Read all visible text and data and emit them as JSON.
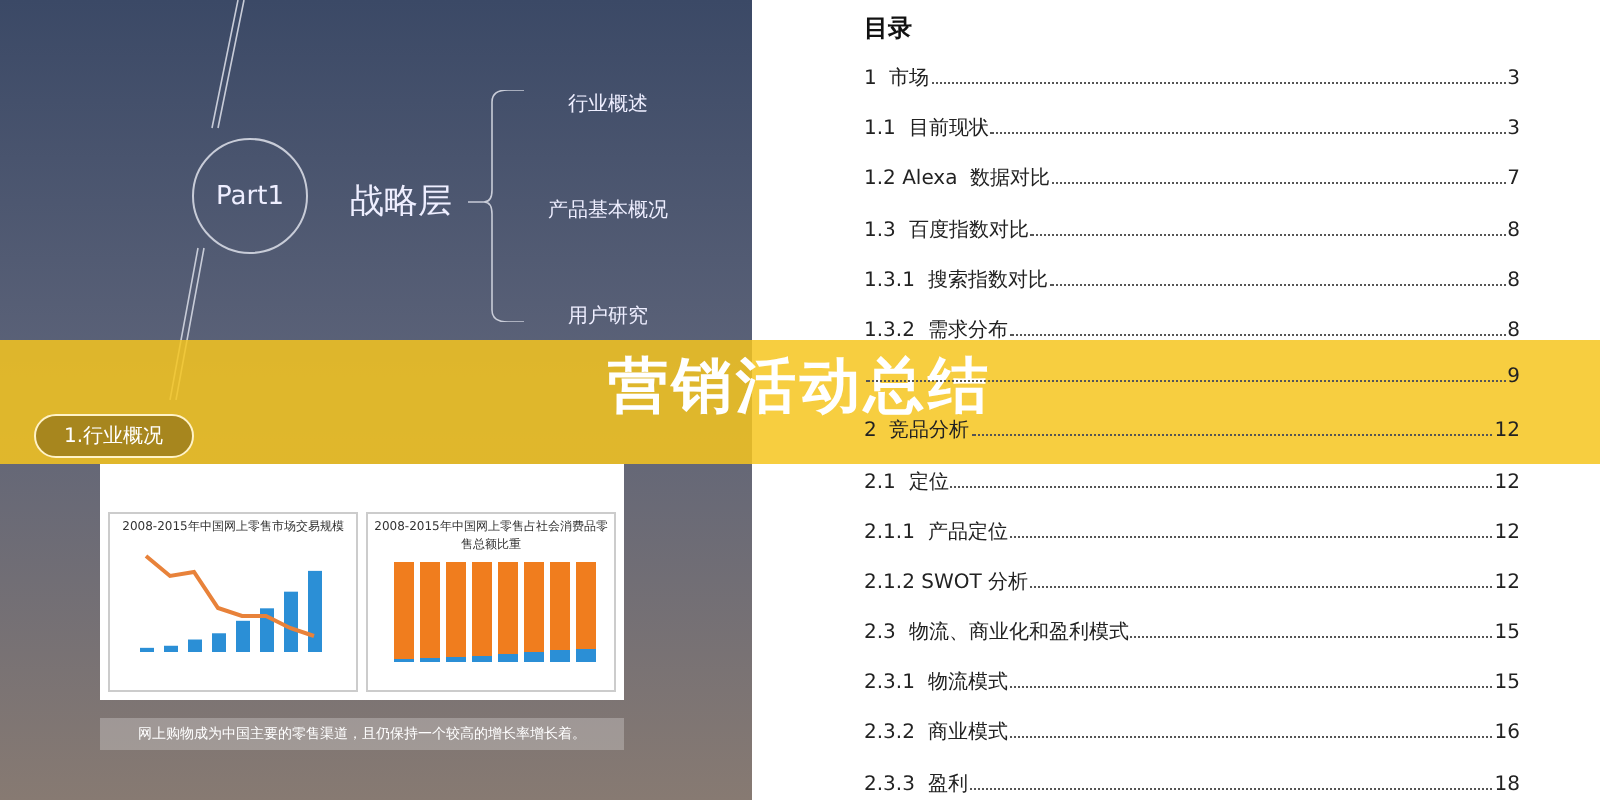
{
  "slide": {
    "part_label": "Part1",
    "layer_title": "战略层",
    "topics": [
      "行业概述",
      "产品基本概况",
      "用户研究"
    ],
    "section_tag": "1.行业概况",
    "charts": [
      {
        "kind": "bar_line",
        "title": "2008-2015年中国网上零售市场交易规模"
      },
      {
        "kind": "stacked",
        "title": "2008-2015年中国网上零售占社会消费品零售总额比重"
      }
    ],
    "caption": "网上购物成为中国主要的零售渠道，且仍保持一个较高的增长率增长着。"
  },
  "toc": {
    "title": "目录",
    "entries": [
      {
        "label": "1  市场",
        "page": "3"
      },
      {
        "label": "1.1  目前现状",
        "page": "3"
      },
      {
        "label": "1.2 Alexa  数据对比",
        "page": "7"
      },
      {
        "label": "1.3  百度指数对比",
        "page": "8"
      },
      {
        "label": "1.3.1  搜索指数对比",
        "page": "8"
      },
      {
        "label": "1.3.2  需求分布",
        "page": "8"
      },
      {
        "page": "9"
      },
      {
        "label": "2  竞品分析",
        "page": "12"
      },
      {
        "label": "2.1  定位",
        "page": "12"
      },
      {
        "label": "2.1.1  产品定位",
        "page": "12"
      },
      {
        "label": "2.1.2 SWOT 分析",
        "page": "12"
      },
      {
        "label": "2.3  物流、商业化和盈利模式",
        "page": "15"
      },
      {
        "label": "2.3.1  物流模式",
        "page": "15"
      },
      {
        "label": "2.3.2  商业模式",
        "page": "16"
      },
      {
        "label": "2.3.3  盈利",
        "page": "18"
      }
    ]
  },
  "banner": {
    "title": "营销活动总结"
  }
}
